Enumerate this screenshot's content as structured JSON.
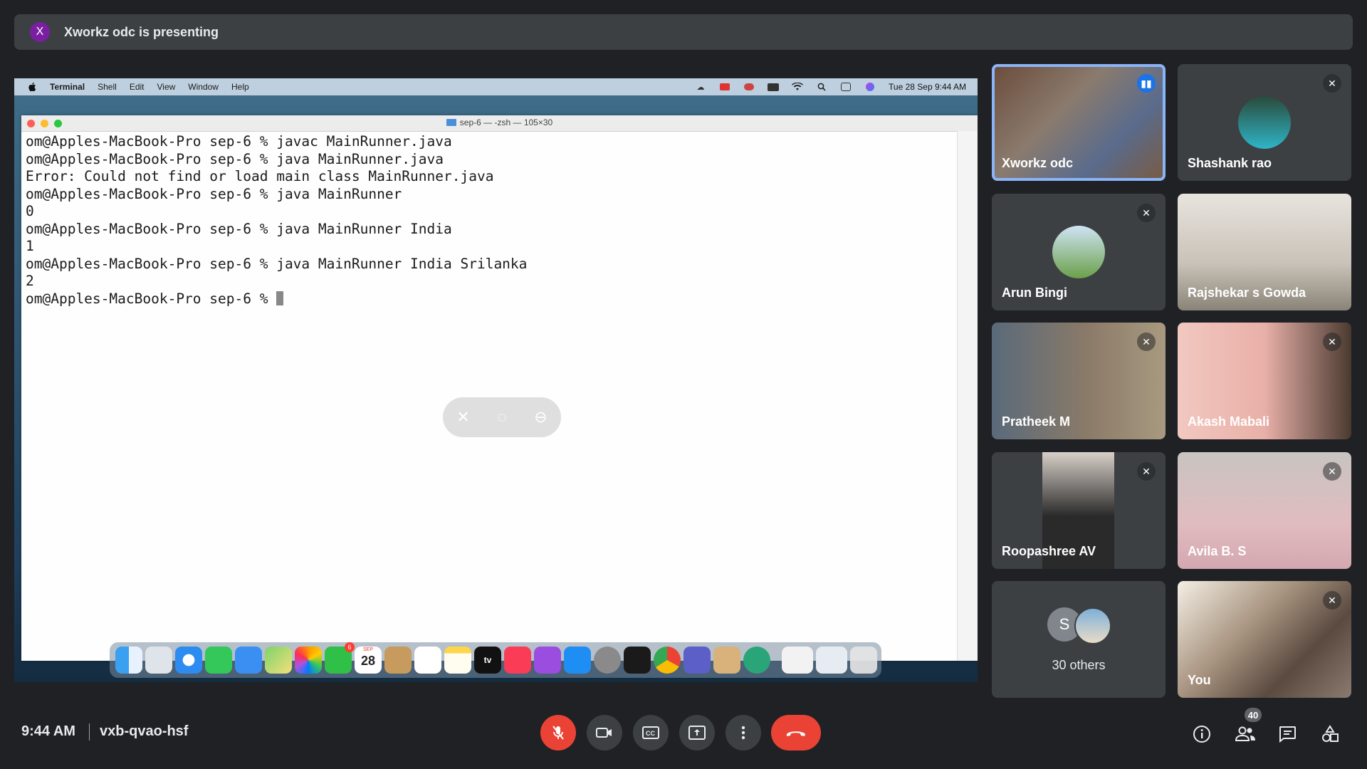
{
  "banner": {
    "avatar_letter": "X",
    "text": "Xworkz odc is presenting"
  },
  "mac": {
    "menu": [
      "Terminal",
      "Shell",
      "Edit",
      "View",
      "Window",
      "Help"
    ],
    "datetime": "Tue 28 Sep  9:44 AM",
    "window_title": "sep-6 — -zsh — 105×30",
    "terminal_lines": [
      "om@Apples-MacBook-Pro sep-6 % javac MainRunner.java",
      "om@Apples-MacBook-Pro sep-6 % java MainRunner.java",
      "Error: Could not find or load main class MainRunner.java",
      "om@Apples-MacBook-Pro sep-6 % java MainRunner",
      "0",
      "om@Apples-MacBook-Pro sep-6 % java MainRunner India",
      "1",
      "om@Apples-MacBook-Pro sep-6 % java MainRunner India Srilanka",
      "2",
      "om@Apples-MacBook-Pro sep-6 % "
    ],
    "dock_calendar_day": "28",
    "dock_calendar_month": "SEP",
    "dock_tv_label": "tv",
    "dock_badge": "6"
  },
  "participants": [
    {
      "name": "Xworkz odc",
      "muted": false,
      "speaking": true
    },
    {
      "name": "Shashank rao",
      "muted": true
    },
    {
      "name": "Arun Bingi",
      "muted": true
    },
    {
      "name": "Rajshekar s Gowda",
      "muted": false
    },
    {
      "name": "Pratheek M",
      "muted": true
    },
    {
      "name": "Akash Mabali",
      "muted": true
    },
    {
      "name": "Roopashree AV",
      "muted": true
    },
    {
      "name": "Avila B. S",
      "muted": true
    },
    {
      "name": "30 others",
      "avatar_letter": "S"
    },
    {
      "name": "You",
      "muted": true
    }
  ],
  "bottom": {
    "time": "9:44 AM",
    "meeting_code": "vxb-qvao-hsf",
    "participant_count": "40"
  },
  "colors": {
    "end_call": "#ea4335",
    "mic_off": "#ea4335",
    "speaking_border": "#8ab4f8"
  }
}
